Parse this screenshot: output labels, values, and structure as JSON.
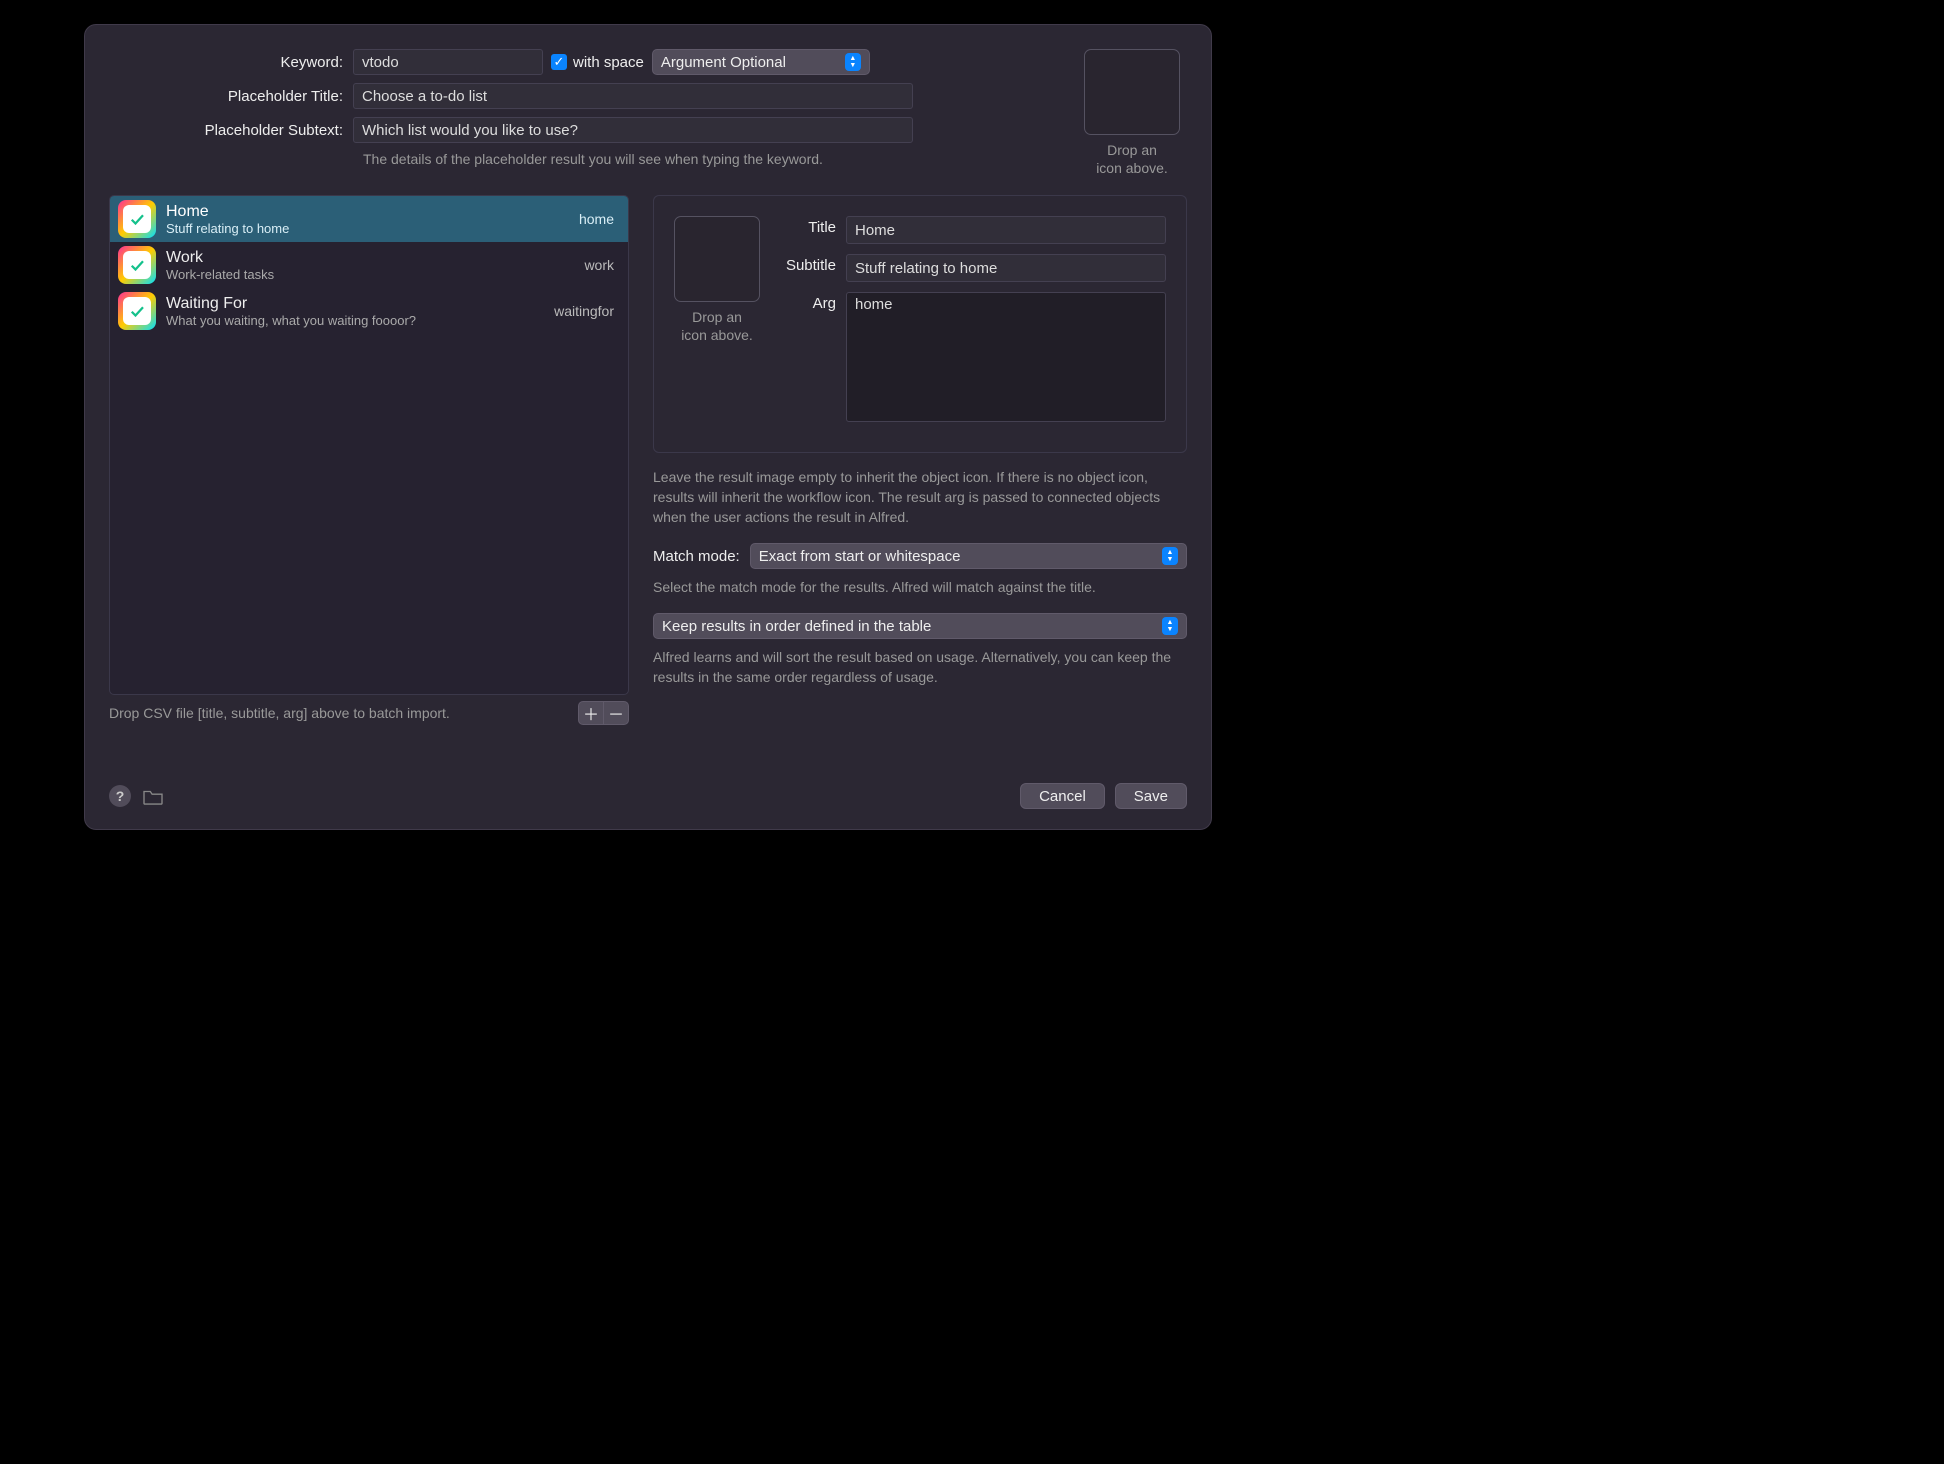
{
  "form": {
    "keyword_label": "Keyword:",
    "keyword_value": "vtodo",
    "with_space_label": "with space",
    "with_space_checked": true,
    "argument_mode": "Argument Optional",
    "placeholder_title_label": "Placeholder Title:",
    "placeholder_title_value": "Choose a to-do list",
    "placeholder_subtext_label": "Placeholder Subtext:",
    "placeholder_subtext_value": "Which list would you like to use?",
    "helper": "The details of the placeholder result you will see when typing the keyword."
  },
  "icon_well": {
    "line1": "Drop an",
    "line2": "icon above."
  },
  "list": {
    "items": [
      {
        "title": "Home",
        "subtitle": "Stuff relating to home",
        "arg": "home"
      },
      {
        "title": "Work",
        "subtitle": "Work-related tasks",
        "arg": "work"
      },
      {
        "title": "Waiting For",
        "subtitle": "What you waiting, what you waiting foooor?",
        "arg": "waitingfor"
      }
    ],
    "selected_index": 0,
    "csv_hint": "Drop CSV file [title, subtitle, arg] above to batch import."
  },
  "detail": {
    "title_label": "Title",
    "title_value": "Home",
    "subtitle_label": "Subtitle",
    "subtitle_value": "Stuff relating to home",
    "arg_label": "Arg",
    "arg_value": "home",
    "icon_hint1": "Drop an",
    "icon_hint2": "icon above.",
    "below_text": "Leave the result image empty to inherit the object icon. If there is no object icon, results will inherit the workflow icon. The result arg is passed to connected objects when the user actions the result in Alfred.",
    "match_mode_label": "Match mode:",
    "match_mode_value": "Exact from start or whitespace",
    "match_mode_help": "Select the match mode for the results. Alfred will match against the title.",
    "order_value": "Keep results in order defined in the table",
    "order_help": "Alfred learns and will sort the result based on usage. Alternatively, you can keep the results in the same order regardless of usage."
  },
  "footer": {
    "cancel": "Cancel",
    "save": "Save"
  }
}
